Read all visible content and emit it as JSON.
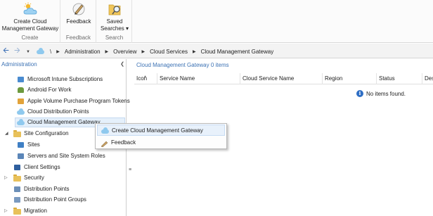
{
  "ribbon": {
    "groups": [
      {
        "label": "Create",
        "buttons": [
          {
            "label": "Create Cloud Management Gateway",
            "icon": "cloud-sun-icon"
          }
        ]
      },
      {
        "label": "Feedback",
        "buttons": [
          {
            "label": "Feedback",
            "icon": "feedback-pen-icon"
          }
        ]
      },
      {
        "label": "Search",
        "buttons": [
          {
            "label": "Saved Searches",
            "icon": "saved-search-icon"
          }
        ]
      }
    ],
    "create_btn_line1": "Create Cloud",
    "create_btn_line2": "Management Gateway",
    "feedback_btn": "Feedback",
    "saved_line1": "Saved",
    "saved_line2": "Searches ▾"
  },
  "address_bar": {
    "path_root": "\\",
    "crumbs": [
      "Administration",
      "Overview",
      "Cloud Services",
      "Cloud Management Gateway"
    ]
  },
  "left_pane": {
    "header": "Administration",
    "items": [
      {
        "label": "Microsoft Intune Subscriptions",
        "icon": "intune-icon"
      },
      {
        "label": "Android For Work",
        "icon": "android-icon"
      },
      {
        "label": "Apple Volume Purchase Program Tokens",
        "icon": "apple-vpp-icon"
      },
      {
        "label": "Cloud Distribution Points",
        "icon": "cloud-icon"
      },
      {
        "label": "Cloud Management Gateway",
        "icon": "cloud-icon",
        "selected": true
      },
      {
        "label": "Site Configuration",
        "icon": "folder-icon",
        "expanded": true
      },
      {
        "label": "Sites",
        "icon": "sites-icon"
      },
      {
        "label": "Servers and Site System Roles",
        "icon": "servers-icon"
      },
      {
        "label": "Client Settings",
        "icon": "client-settings-icon"
      },
      {
        "label": "Security",
        "icon": "folder-icon"
      },
      {
        "label": "Distribution Points",
        "icon": "distribution-points-icon"
      },
      {
        "label": "Distribution Point Groups",
        "icon": "dp-groups-icon"
      },
      {
        "label": "Migration",
        "icon": "folder-icon"
      }
    ]
  },
  "right_pane": {
    "header": "Cloud Management Gateway 0 items",
    "columns": [
      "Icon",
      "Service Name",
      "Cloud Service Name",
      "Region",
      "Status",
      "Des"
    ],
    "empty_message": "No items found."
  },
  "context_menu": {
    "items": [
      {
        "label": "Create Cloud Management Gateway",
        "icon": "cloud-icon",
        "highlighted": true
      },
      {
        "label": "Feedback",
        "icon": "feedback-pen-icon"
      }
    ]
  },
  "colors": {
    "accent": "#3c72b4",
    "selection": "#e5f0fb",
    "folder": "#e8c15a",
    "cloud": "#8fc9ee"
  }
}
